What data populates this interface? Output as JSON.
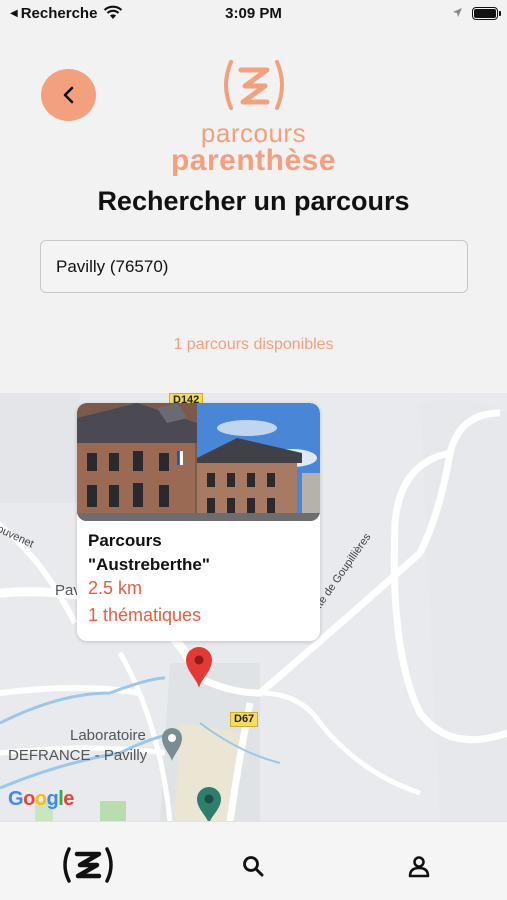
{
  "status_bar": {
    "back_app": "Recherche",
    "time": "3:09 PM"
  },
  "header": {
    "logo_line1": "parcours",
    "logo_line2": "parenthèse",
    "title": "Rechercher un parcours"
  },
  "search": {
    "value": "Pavilly (76570)"
  },
  "results": {
    "count_text": "1 parcours disponibles"
  },
  "map": {
    "road_badges": [
      "D142",
      "D67"
    ],
    "road_labels": [
      "Rte de Goupillières",
      "ouvenet"
    ],
    "place_labels": [
      "Pav",
      "Laboratoire",
      "DEFRANCE - Pavilly"
    ],
    "google_letters": [
      "G",
      "o",
      "o",
      "g",
      "l",
      "e"
    ],
    "google_colors": [
      "#4285f4",
      "#ea4335",
      "#fbbc05",
      "#4285f4",
      "#34a853",
      "#ea4335"
    ]
  },
  "callout": {
    "name_line1": "Parcours",
    "name_line2": "\"Austreberthe\"",
    "distance": "2.5 km",
    "themes": "1 thématiques"
  },
  "colors": {
    "accent": "#f2a07d",
    "highlight": "#e85d3f",
    "pin_red": "#e53935",
    "pin_teal": "#2f7d6d"
  },
  "tab_bar": {
    "items": [
      "home-logo-icon",
      "search-icon",
      "user-icon"
    ]
  }
}
